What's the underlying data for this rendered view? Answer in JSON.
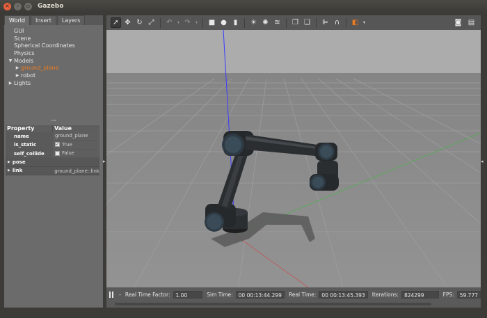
{
  "window": {
    "title": "Gazebo"
  },
  "tabs": [
    "World",
    "Insert",
    "Layers"
  ],
  "tree": {
    "gui": "GUI",
    "scene": "Scene",
    "spherical": "Spherical Coordinates",
    "physics": "Physics",
    "models": "Models",
    "ground_plane": "ground_plane",
    "robot": "robot",
    "lights": "Lights"
  },
  "properties": {
    "header_property": "Property",
    "header_value": "Value",
    "name_key": "name",
    "name_val": "ground_plane",
    "is_static_key": "is_static",
    "is_static_val": "True",
    "self_collide_key": "self_collide",
    "self_collide_val": "False",
    "pose_key": "pose",
    "link_key": "link",
    "link_val": "ground_plane::link"
  },
  "status": {
    "rtf_label": "Real Time Factor:",
    "rtf_value": "1.00",
    "sim_label": "Sim Time:",
    "sim_value": "00 00:13:44.299",
    "real_label": "Real Time:",
    "real_value": "00 00:13:45.393",
    "iter_label": "Iterations:",
    "iter_value": "824299",
    "fps_label": "FPS:",
    "fps_value": "59.777",
    "dash": "-"
  },
  "colors": {
    "accent": "#f07b1d",
    "sky": "#ababab",
    "ground": "#8c8c8c",
    "robot": "#2b2e31"
  }
}
